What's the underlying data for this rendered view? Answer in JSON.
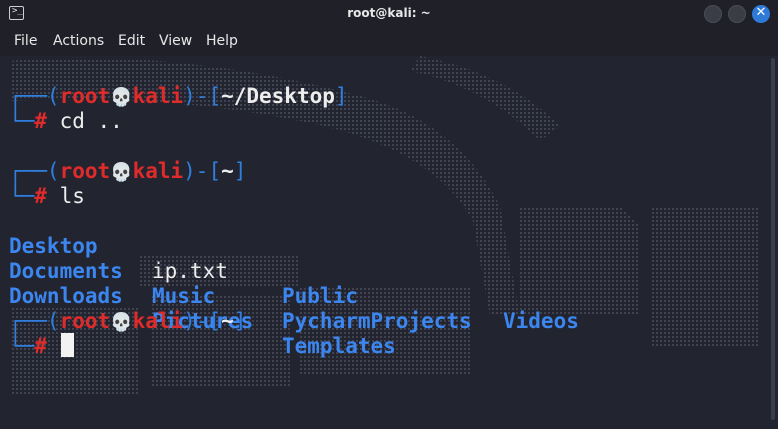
{
  "window": {
    "title": "root@kali: ~",
    "icon": "terminal-icon",
    "close_glyph": "✕"
  },
  "menu": {
    "items": [
      "File",
      "Actions",
      "Edit",
      "View",
      "Help"
    ]
  },
  "terminal": {
    "prompts": [
      {
        "user": "root",
        "host": "kali",
        "path": "~/Desktop",
        "command": "cd .."
      },
      {
        "user": "root",
        "host": "kali",
        "path": "~",
        "command": "ls"
      },
      {
        "user": "root",
        "host": "kali",
        "path": "~",
        "command": ""
      }
    ],
    "ls_output": {
      "columns": [
        [
          "Desktop",
          "Documents",
          "Downloads"
        ],
        [
          "ip.txt",
          "Music",
          "Pictures"
        ],
        [
          "Public",
          "PycharmProjects",
          "Templates"
        ],
        [
          "Videos"
        ]
      ],
      "file_entries": [
        "ip.txt"
      ]
    },
    "glyphs": {
      "corner_top": "┌──(",
      "corner_bottom": "└─",
      "skull": "💀",
      "close_paren_dash": ")-[",
      "close_bracket": "]",
      "hash": "#"
    }
  },
  "colors": {
    "background": "#22242f",
    "blue": "#2f7fe0",
    "red": "#e02b2b",
    "directory": "#3c86f0",
    "close_button": "#2f7ad8"
  }
}
